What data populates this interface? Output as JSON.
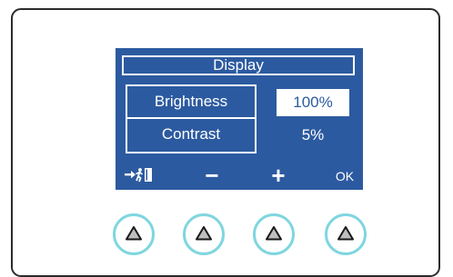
{
  "screen": {
    "title": "Display",
    "menu_items": [
      {
        "label": "Brightness",
        "value": "100%",
        "selected": true
      },
      {
        "label": "Contrast",
        "value": "5%",
        "selected": false
      }
    ]
  },
  "softkeys": {
    "exit_icon": "exit-door-icon",
    "minus_label": "−",
    "plus_label": "+",
    "ok_label": "OK"
  },
  "hardware_buttons": [
    {
      "icon": "triangle-up-icon"
    },
    {
      "icon": "triangle-up-icon"
    },
    {
      "icon": "triangle-up-icon"
    },
    {
      "icon": "triangle-up-icon"
    }
  ],
  "colors": {
    "lcd_background": "#2c5aa0",
    "lcd_foreground": "#ffffff",
    "button_ring": "#7fd6df",
    "button_icon_fill": "#bfbfbf"
  }
}
